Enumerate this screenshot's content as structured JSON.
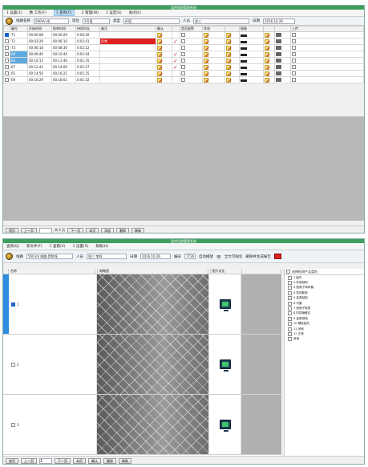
{
  "window1": {
    "title": "监控回放管理系统",
    "menu": [
      "1 设置(1)",
      "数 工作(F)",
      "1 查询(C)",
      "2 管理(W)",
      "1 设定(S)",
      "关闭(E)"
    ],
    "menu_active_index": 2,
    "toolbar": {
      "label_line": "线路名称",
      "line_value": "500kV 线",
      "label_tower": "塔位",
      "tower_value": "1号塔",
      "label_type": "类型",
      "type_value": "杆塔",
      "label_user": "人员",
      "user_value": "张三",
      "label_date": "日期",
      "date_value": "2016.10.26"
    },
    "columns": [
      "",
      "编号",
      "开始时间",
      "结束时间",
      "持续时长",
      "备注",
      "确认",
      "",
      "是否报警",
      "状态",
      "",
      "图像",
      "",
      "",
      "上传"
    ],
    "rows": [
      {
        "no": "71",
        "start": "00:00:08",
        "end": "00:00:29",
        "dur": "0:00:20",
        "note": "",
        "highlight": false,
        "checked": true,
        "flag": false,
        "tick": false
      },
      {
        "no": "72",
        "start": "00:03:29",
        "end": "00:06:10",
        "dur": "0:02:41",
        "note": "异常",
        "highlight": false,
        "checked": false,
        "flag": true,
        "tick": true
      },
      {
        "no": "73",
        "start": "00:06:18",
        "end": "00:08:30",
        "dur": "0:02:12",
        "note": "",
        "highlight": false,
        "checked": false,
        "flag": false,
        "tick": false
      },
      {
        "no": "68",
        "start": "00:09:40",
        "end": "00:10:44",
        "dur": "0:01:04",
        "note": "",
        "highlight": true,
        "checked": false,
        "flag": false,
        "tick": true
      },
      {
        "no": "66",
        "start": "00:10:11",
        "end": "00:11:46",
        "dur": "0:01:35",
        "note": "",
        "highlight": true,
        "checked": false,
        "flag": false,
        "tick": true
      },
      {
        "no": "67",
        "start": "00:12:42",
        "end": "00:14:09",
        "dur": "0:01:27",
        "note": "",
        "highlight": false,
        "checked": false,
        "flag": false,
        "tick": true
      },
      {
        "no": "65",
        "start": "00:14:56",
        "end": "00:16:21",
        "dur": "0:01:25",
        "note": "",
        "highlight": false,
        "checked": false,
        "flag": false,
        "tick": false
      },
      {
        "no": "69",
        "start": "00:16:29",
        "end": "00:18:01",
        "dur": "0:01:32",
        "note": "",
        "highlight": false,
        "checked": false,
        "flag": false,
        "tick": false
      }
    ],
    "footer": {
      "first": "首页",
      "prev": "上一页",
      "page_of": "共 4 页",
      "next": "下一页",
      "last": "末页",
      "add": "添加",
      "delete": "删除",
      "refresh": "刷新"
    }
  },
  "window2": {
    "title": "监控回放管理系统",
    "menu": [
      "查询(Q)",
      "新文件(F)",
      "1 查看(V)",
      "1 设置(S)",
      "帮助(H)"
    ],
    "toolbar": {
      "label_line": "线路",
      "line_value": "500 kV 线路 伊犁线",
      "label_user": "人员",
      "user_value": "张三 李四",
      "label_date": "日期",
      "date_value": "2016.10.26",
      "label_no": "编号",
      "no_value": "7726",
      "mode": "自动播放",
      "link": "全文可视化",
      "gen": "删除并生成报告"
    },
    "list_head": [
      "",
      "名称",
      "",
      "缩略图",
      "",
      "图片对比",
      ""
    ],
    "rows": [
      {
        "label": "1",
        "selected": true
      },
      {
        "label": "2",
        "selected": false
      },
      {
        "label": "3",
        "selected": false
      }
    ],
    "side_panel": {
      "header": "选择检测产品类别",
      "items": [
        "1 缺失",
        "2 杆塔倾斜",
        "3 绝缘子串风偏",
        "4 导线断股",
        "5 金具缺陷",
        "6 鸟巢",
        "7 绝缘子破损",
        "8 防振锤移位",
        "9 金具锈蚀",
        "10 螺栓缺失",
        "11 其他",
        "12 正常",
        "其他"
      ]
    },
    "footer": {
      "first": "首页",
      "prev": "上一页",
      "page": "1",
      "next": "下一页",
      "last": "末页",
      "confirm": "确认",
      "delete": "删除",
      "refresh": "刷新"
    }
  }
}
